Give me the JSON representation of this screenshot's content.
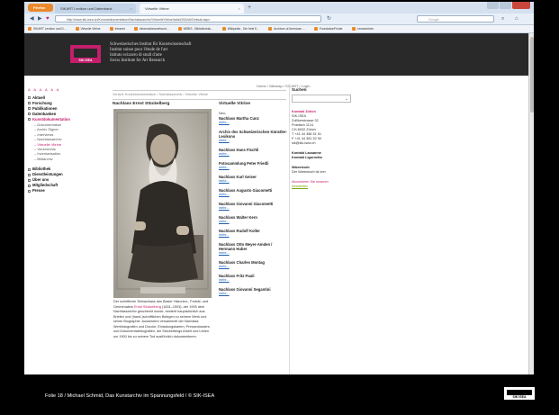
{
  "browser": {
    "app_button": "Firefox",
    "tabs": [
      {
        "label": "SIKART Lexikon und Datenbank"
      },
      {
        "label": "Virtuelle Vitrine"
      }
    ],
    "new_tab": "+",
    "url": "http://www.sik-isea.ch/Kunstdokumentation/Nachlassarchiv/VirtuelleVitrine/tabid/263/ctl/Default.aspx",
    "search_placeholder": "Google",
    "bookmarks": [
      "SIKART Lexikon und D...",
      "Virtuelle Vitrine",
      "Intranet",
      "Informationsverbund...",
      "NEBIS - Bibliotheksk...",
      "Wikipedia - Die freie E...",
      "Archives of American ...",
      "FoundationFinder",
      "Lesezeichen"
    ]
  },
  "site": {
    "logo_text": "SIK ISEA",
    "institute_names": [
      "Schweizerisches Institut für Kunstwissenschaft",
      "Institut suisse pour l'étude de l'art",
      "Istituto svizzero di studi d'arte",
      "Swiss Institute for Art Research"
    ],
    "text_size_label": "A A A A A A",
    "top_links": "Home / Sitemap / SIKART / Login",
    "breadcrumb": "Verlauf:  Kunstdokumentation / Nachlassarchiv / Virtuelle Vitrine",
    "nav_groups": [
      [
        {
          "label": "Aktuell",
          "active": false,
          "sub": false
        },
        {
          "label": "Forschung",
          "active": false,
          "sub": false
        },
        {
          "label": "Publikationen",
          "active": false,
          "sub": false
        },
        {
          "label": "Datenbanken",
          "active": false,
          "sub": false
        },
        {
          "label": "Kunstdokumentation",
          "active": true,
          "sub": false
        },
        {
          "label": "Dokumentation",
          "active": false,
          "sub": true
        },
        {
          "label": "Archiv Signer",
          "active": false,
          "sub": true
        },
        {
          "label": "Interviews",
          "active": false,
          "sub": true
        },
        {
          "label": "Nachlassarchiv",
          "active": false,
          "sub": true
        },
        {
          "label": "Virtuelle Vitrine",
          "active": true,
          "sub": true
        },
        {
          "label": "Verzeichnis",
          "active": false,
          "sub": true
        },
        {
          "label": "Inventarisation",
          "active": false,
          "sub": true
        },
        {
          "label": "Bildarchiv",
          "active": false,
          "sub": true
        }
      ],
      [
        {
          "label": "Bibliothek",
          "active": false,
          "sub": false
        },
        {
          "label": "Dienstleistungen",
          "active": false,
          "sub": false
        },
        {
          "label": "Über uns",
          "active": false,
          "sub": false
        },
        {
          "label": "Mitgliedschaft",
          "active": false,
          "sub": false
        },
        {
          "label": "Presse",
          "active": false,
          "sub": false
        }
      ]
    ],
    "page_title": "Nachlass Ernst Stückelberg",
    "caption_parts": [
      "Der schriftliche Teilnachlass des Basler Historien-, Porträt- und Genremalers ",
      "Ernst Stückelberg",
      " (1831–1903), der 1993 dem Nachlassarchiv geschenkt wurde, besteht hauptsächlich aus Briefen und (hand-)schriftlichen Belegen zu seinem Werk und seiner Biographie. Ausserdem versammelt der Nachlass Werkfotografien und Drucke, Einladungskarten, Pressedossiers und Dokumentarfotografien, die Stückelbergs Arbeit und Leben um 1900 bis zu seinem Tod ausführlich dokumentieren."
    ],
    "vitrine": {
      "title": "Virtuelle Vitrine",
      "neu": "Neu:",
      "mehr": "mehr...",
      "items": [
        "Nachlass Martha Cunz",
        "Archiv des Schweizerischen Künstler-Lexikons",
        "Nachlass Hans Fischli",
        "Fotosammlung Peter Friedli",
        "Nachlass Karl Geiser",
        "Nachlass Augusto Giacometti",
        "Nachlass Giovanni Giacometti",
        "Nachlass Walter Kern",
        "Nachlass Rudolf Koller",
        "Nachlass Otto Meyer-Amden / Hermann Huber",
        "Nachlass Charles Montag",
        "Nachlass Fritz Pauli",
        "Nachlass Giovanni Segantini"
      ]
    },
    "sidebar": {
      "search_title": "Suchen",
      "contact_title": "Kontakt Zürich",
      "contact_lines": [
        "SIK-ISEA",
        "Zollikerstrasse 32",
        "Postfach 1124",
        "CH-8032 Zürich",
        "T +41 44 388 51 51",
        "F +41 44 381 52 50",
        "sik@sik-isea.ch"
      ],
      "contact_lausanne": "Kontakt Lausanne",
      "contact_lugano": "Kontakt Ligornetto",
      "warenkorb_title": "Warenkorb",
      "warenkorb_text": "Der Warenkorb ist leer",
      "abo_pink": "Abonnieren Sie unseren",
      "abo_green": "Newsletter"
    }
  },
  "slide": {
    "footer": "Folie 18 / Michael Schmid, Das Kunstarchiv im Spannungsfeld / © SIK-ISEA",
    "logo_text": "SIK ISEA"
  }
}
